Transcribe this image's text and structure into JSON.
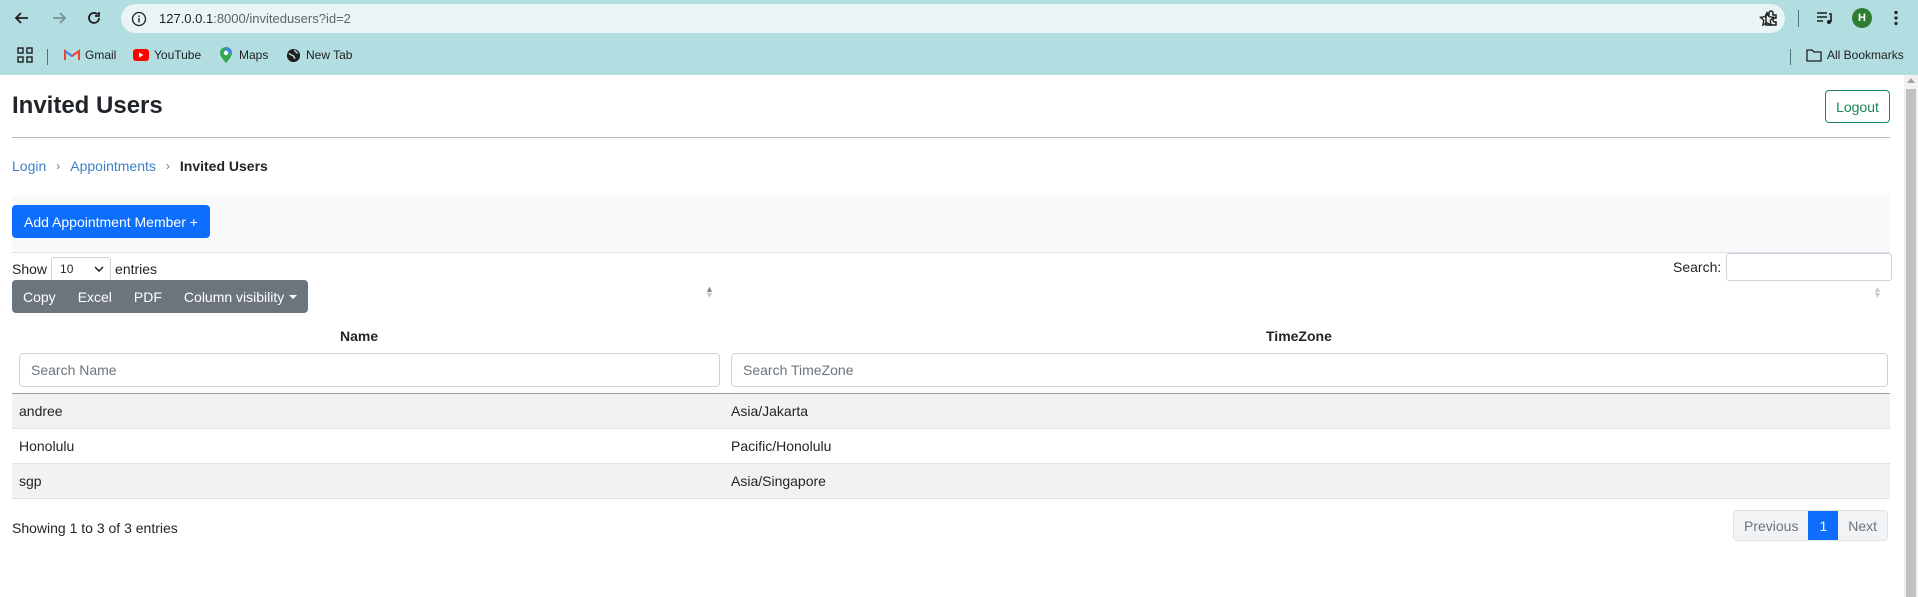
{
  "browser": {
    "url_host": "127.0.0.1",
    "url_rest": ":8000/invitedusers?id=2",
    "profile_initial": "H",
    "bookmarks": [
      {
        "label": "Gmail",
        "icon": "gmail-icon"
      },
      {
        "label": "YouTube",
        "icon": "youtube-icon"
      },
      {
        "label": "Maps",
        "icon": "maps-icon"
      },
      {
        "label": "New Tab",
        "icon": "globe-icon"
      }
    ],
    "all_bookmarks": "All Bookmarks"
  },
  "page": {
    "title": "Invited Users",
    "logout_label": "Logout",
    "breadcrumb": {
      "items": [
        "Login",
        "Appointments"
      ],
      "current": "Invited Users"
    },
    "add_button": "Add Appointment Member +",
    "show_label": "Show",
    "entries_label": "entries",
    "page_length": "10",
    "search_label": "Search:",
    "export_buttons": [
      "Copy",
      "Excel",
      "PDF",
      "Column visibility"
    ],
    "table": {
      "columns": [
        "Name",
        "TimeZone"
      ],
      "filter_placeholders": [
        "Search Name",
        "Search TimeZone"
      ],
      "rows": [
        {
          "name": "andree",
          "timezone": "Asia/Jakarta"
        },
        {
          "name": "Honolulu",
          "timezone": "Pacific/Honolulu"
        },
        {
          "name": "sgp",
          "timezone": "Asia/Singapore"
        }
      ]
    },
    "info_text": "Showing 1 to 3 of 3 entries",
    "pagination": {
      "previous": "Previous",
      "current": "1",
      "next": "Next"
    }
  }
}
